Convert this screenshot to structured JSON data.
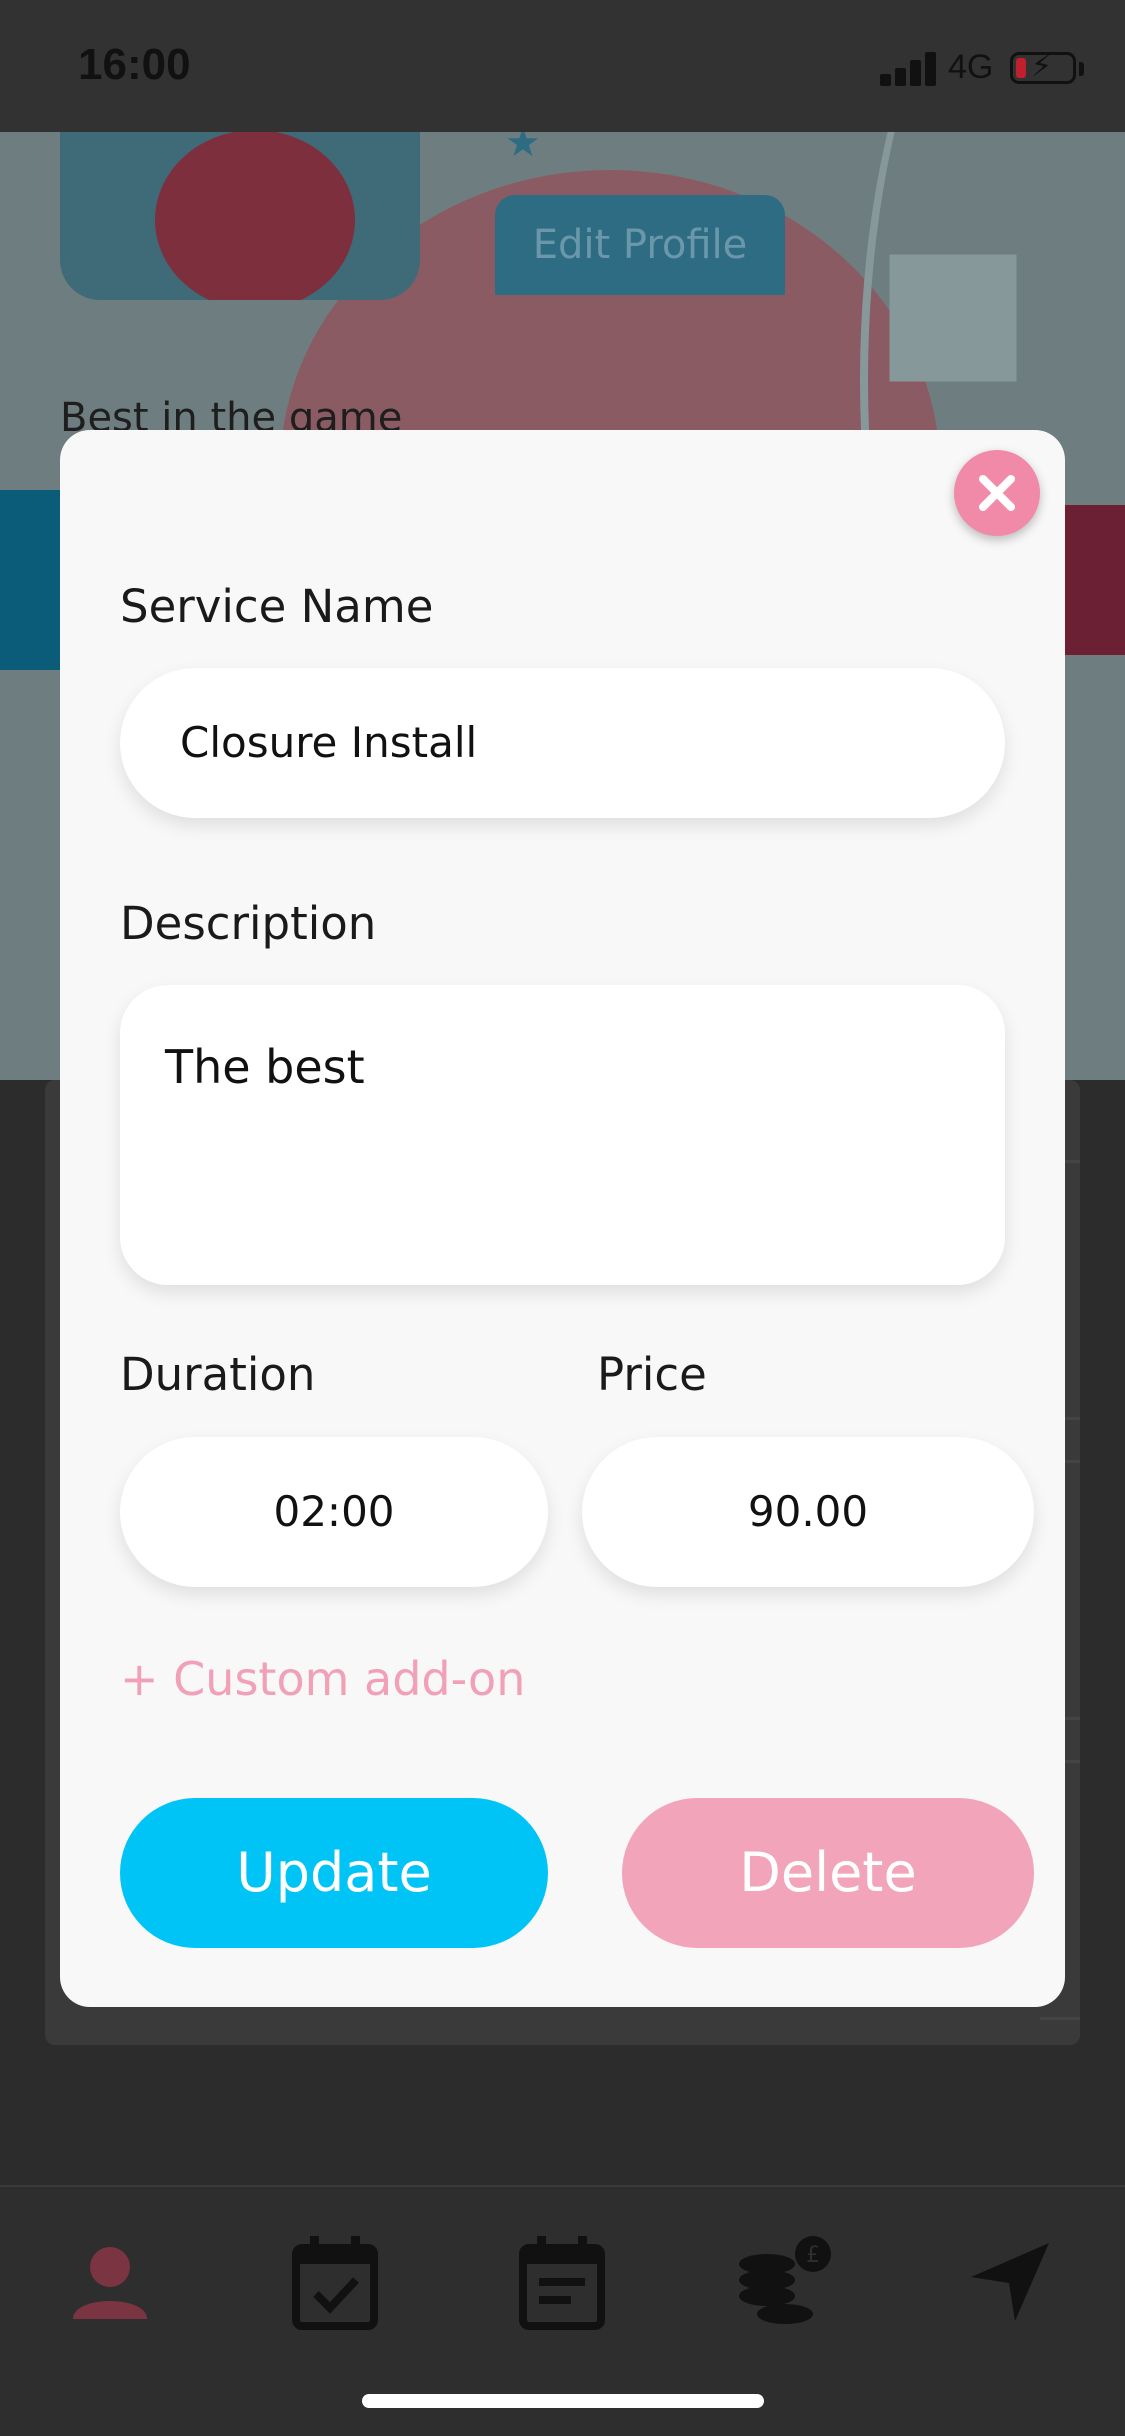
{
  "status_bar": {
    "time": "16:00",
    "network": "4G"
  },
  "background": {
    "edit_profile_label": "Edit Profile",
    "bio_text": "Best in the game"
  },
  "modal": {
    "service_name": {
      "label": "Service Name",
      "value": "Closure Install"
    },
    "description": {
      "label": "Description",
      "value": "The best"
    },
    "duration": {
      "label": "Duration",
      "value": "02:00"
    },
    "price": {
      "label": "Price",
      "value": "90.00"
    },
    "custom_addon_label": "+ Custom add-on",
    "update_label": "Update",
    "delete_label": "Delete"
  },
  "tab_bar": {
    "items": [
      {
        "icon": "profile-icon",
        "active": true
      },
      {
        "icon": "calendar-check-icon",
        "active": false
      },
      {
        "icon": "calendar-notes-icon",
        "active": false
      },
      {
        "icon": "coins-pound-icon",
        "active": false
      },
      {
        "icon": "navigation-arrow-icon",
        "active": false
      }
    ]
  },
  "colors": {
    "accent_blue": "#00C4F5",
    "accent_pink": "#F2A4BB",
    "close_pink": "#F08AA8",
    "active_tab": "#7A3442"
  }
}
